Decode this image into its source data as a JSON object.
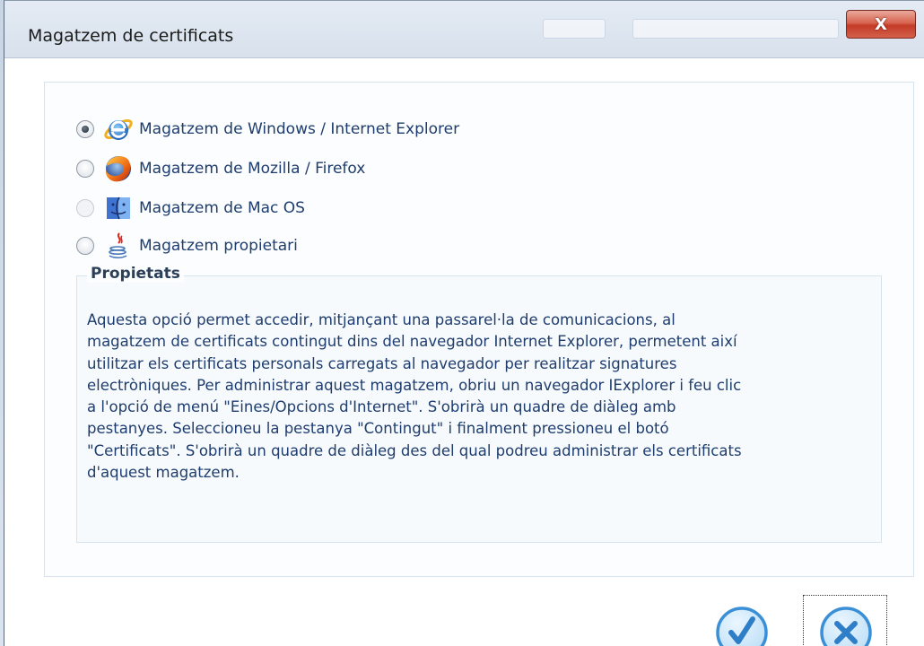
{
  "window": {
    "title": "Magatzem de certificats",
    "close_label": "X"
  },
  "options": [
    {
      "label": "Magatzem de Windows / Internet Explorer",
      "icon": "internet-explorer-icon",
      "checked": true,
      "enabled": true
    },
    {
      "label": "Magatzem de Mozilla / Firefox",
      "icon": "firefox-icon",
      "checked": false,
      "enabled": true
    },
    {
      "label": "Magatzem de Mac OS",
      "icon": "mac-os-finder-icon",
      "checked": false,
      "enabled": false
    },
    {
      "label": "Magatzem propietari",
      "icon": "java-icon",
      "checked": false,
      "enabled": true
    }
  ],
  "properties": {
    "legend": "Propietats",
    "description_lines": [
      "Aquesta opció permet accedir, mitjançant una passarel·la de comunicacions, al",
      "magatzem de certificats contingut dins del navegador Internet Explorer, permetent així",
      "utilitzar els certificats personals carregats al navegador per realitzar signatures",
      "electròniques. Per administrar aquest magatzem, obriu un navegador IExplorer i feu clic",
      "a l'opció de menú \"Eines/Opcions d'Internet\". S'obrirà un quadre de diàleg amb",
      "pestanyes. Seleccioneu la pestanya \"Contingut\" i finalment pressioneu el botó",
      "\"Certificats\". S'obrirà un quadre de diàleg des del qual podreu administrar els certificats",
      "d'aquest magatzem."
    ]
  },
  "buttons": {
    "accept_icon": "checkmark-icon",
    "cancel_icon": "cancel-x-icon"
  },
  "colors": {
    "button_blue": "#3a8fd6",
    "label_text": "#1e3d6e",
    "close_red": "#c33b26"
  }
}
